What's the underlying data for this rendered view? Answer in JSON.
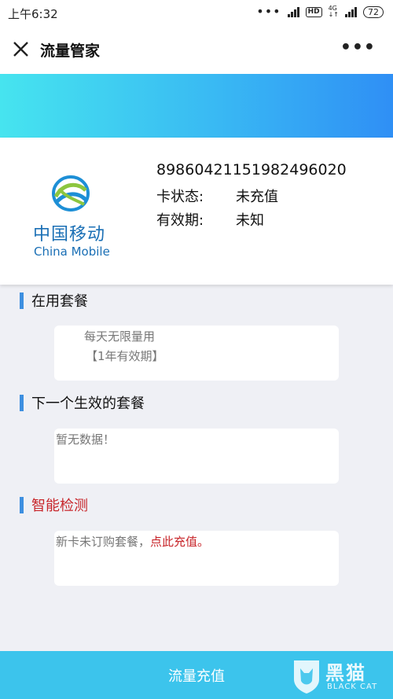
{
  "status_bar": {
    "time": "上午6:32",
    "hd": "HD",
    "network": "4G",
    "battery": "72"
  },
  "header": {
    "title": "流量管家"
  },
  "card": {
    "brand_cn": "中国移动",
    "brand_en": "China Mobile",
    "iccid": "89860421151982496020",
    "rows": [
      {
        "key": "卡状态:",
        "value": "未充值"
      },
      {
        "key": "有效期:",
        "value": "未知"
      }
    ]
  },
  "sections": {
    "current": {
      "title": "在用套餐",
      "line1": "每天无限量用",
      "line2": "【1年有效期】"
    },
    "next": {
      "title": "下一个生效的套餐",
      "line1": "暂无数据！"
    },
    "detect": {
      "title": "智能检测",
      "text": "新卡未订购套餐，",
      "link": "点此充值。"
    }
  },
  "bottom": {
    "cta": "流量充值"
  },
  "watermark": {
    "cn": "黑猫",
    "en": "BLACK CAT"
  },
  "colors": {
    "accent": "#3cc4ec",
    "brand_blue": "#1a6fb5",
    "alert_red": "#c8262b"
  }
}
